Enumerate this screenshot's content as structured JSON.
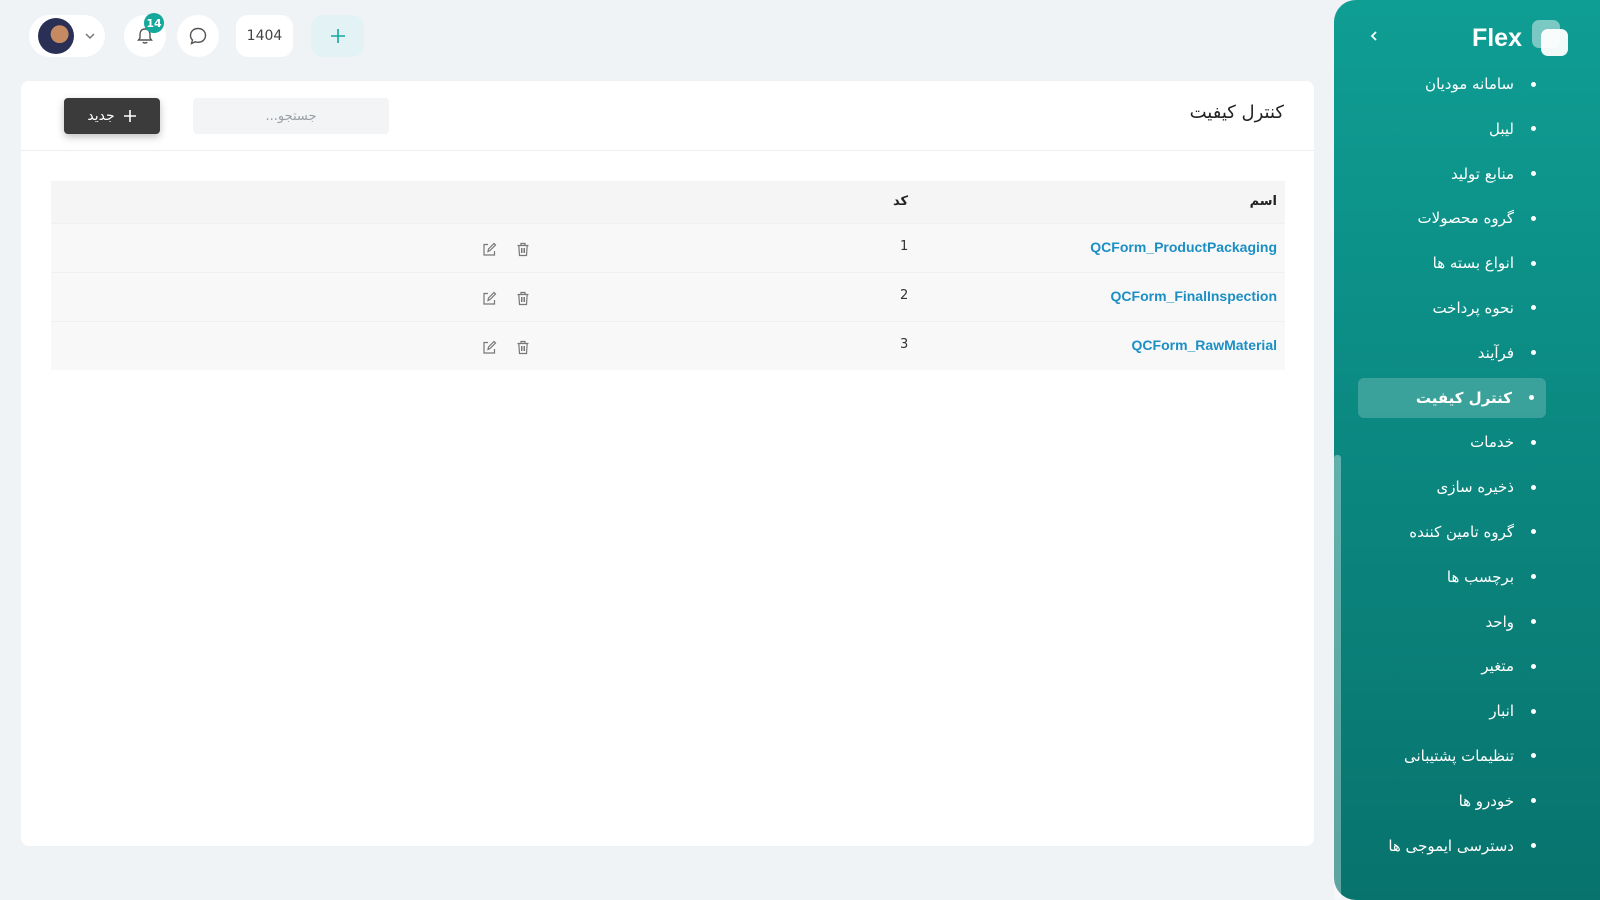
{
  "app": {
    "logo_text": "Flex"
  },
  "topbar": {
    "notifications_count": "14",
    "year": "1404"
  },
  "sidebar": {
    "items": [
      {
        "label": "سامانه مودیان",
        "active": false
      },
      {
        "label": "لیبل",
        "active": false
      },
      {
        "label": "منابع تولید",
        "active": false
      },
      {
        "label": "گروه محصولات",
        "active": false
      },
      {
        "label": "انواع بسته ها",
        "active": false
      },
      {
        "label": "نحوه پرداخت",
        "active": false
      },
      {
        "label": "فرآیند",
        "active": false
      },
      {
        "label": "کنترل کیفیت",
        "active": true
      },
      {
        "label": "خدمات",
        "active": false
      },
      {
        "label": "ذخیره سازی",
        "active": false
      },
      {
        "label": "گروه تامین کننده",
        "active": false
      },
      {
        "label": "برچسب ها",
        "active": false
      },
      {
        "label": "واحد",
        "active": false
      },
      {
        "label": "متغیر",
        "active": false
      },
      {
        "label": "انبار",
        "active": false
      },
      {
        "label": "تنظیمات پشتیبانی",
        "active": false
      },
      {
        "label": "خودرو ها",
        "active": false
      },
      {
        "label": "دسترسی ایموجی ها",
        "active": false
      }
    ]
  },
  "main": {
    "title": "کنترل کیفیت",
    "search_placeholder": "جستجو...",
    "new_button_label": "جدید",
    "table": {
      "columns": {
        "name": "اسم",
        "code": "کد"
      },
      "rows": [
        {
          "name": "QCForm_ProductPackaging",
          "code": "1"
        },
        {
          "name": "QCForm_FinalInspection",
          "code": "2"
        },
        {
          "name": "QCForm_RawMaterial",
          "code": "3"
        }
      ]
    }
  },
  "colors": {
    "brand": "#0f9e94",
    "link": "#1b8fc4",
    "dark_button": "#3b3b3b"
  }
}
